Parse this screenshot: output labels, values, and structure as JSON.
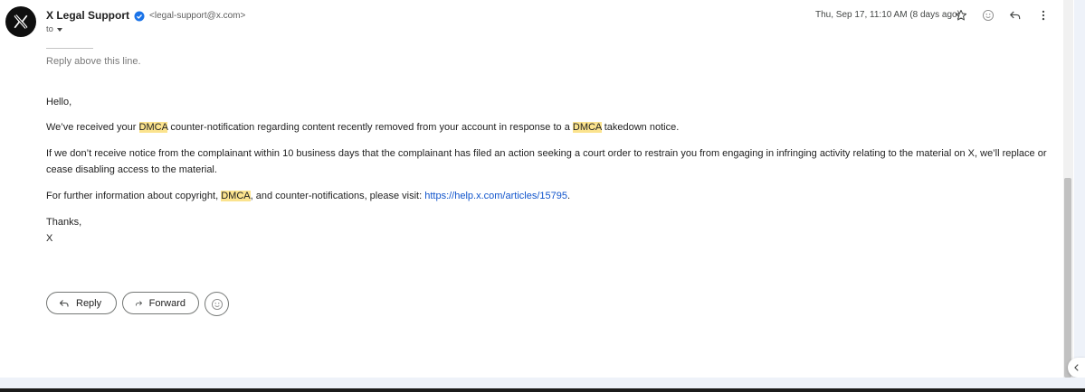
{
  "sender": {
    "name": "X Legal Support",
    "email": "<legal-support@x.com>",
    "to_label": "to"
  },
  "header": {
    "datetime": "Thu, Sep 17, 11:10 AM (8 days ago)",
    "icons": [
      "star-icon",
      "emoji-icon",
      "reply-icon",
      "more-vert-icon"
    ]
  },
  "quoted": {
    "reply_above": "Reply above this line."
  },
  "body": {
    "greeting": "Hello,",
    "p1": {
      "t1": "We’ve received your ",
      "h1": "DMCA",
      "t2": " counter-notification regarding content recently removed from your account in response to a ",
      "h2": "DMCA",
      "t3": " takedown notice."
    },
    "p2": "If we don’t receive notice from the complainant within 10 business days that the complainant has filed an action seeking a court order to restrain you from engaging in infringing activity relating to the material on X, we’ll replace or cease disabling access to the material.",
    "p3": {
      "t1": "For further information about copyright, ",
      "h1": "DMCA",
      "t2": ", and counter-notifications, please visit: ",
      "link": "https://help.x.com/articles/15795",
      "t3": "."
    },
    "signoff": "Thanks,",
    "signature": "X"
  },
  "actions": {
    "reply_label": "Reply",
    "forward_label": "Forward"
  },
  "colors": {
    "highlight": "#fbe38e",
    "link": "#1155cc",
    "verified": "#1a73e8"
  }
}
